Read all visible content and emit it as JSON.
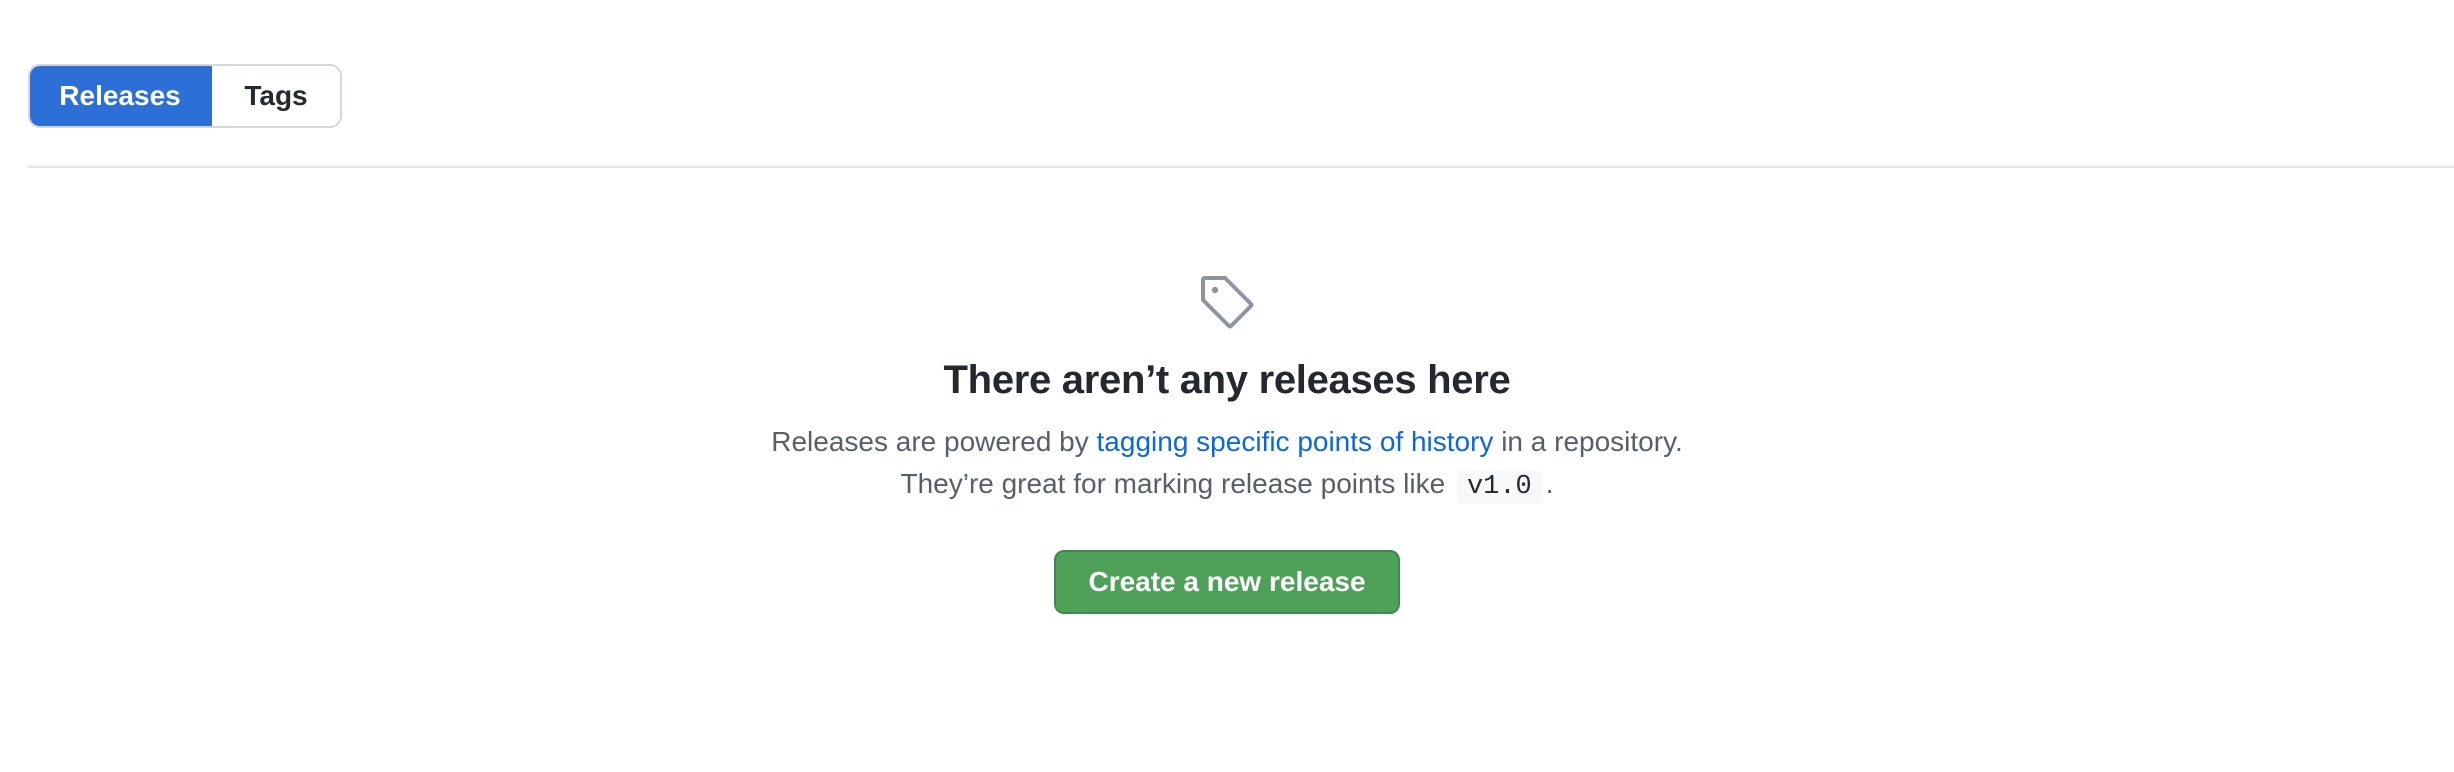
{
  "tabs": {
    "releases_label": "Releases",
    "tags_label": "Tags",
    "selected": "Releases",
    "accent_color": "#2b6fd7"
  },
  "blankslate": {
    "icon": "tag-icon",
    "title": "There aren’t any releases here",
    "line1_prefix": "Releases are powered by ",
    "line1_link": "tagging specific points of history",
    "line1_suffix": " in a repository.",
    "line2_prefix": "They’re great for marking release points like ",
    "line2_code": "v1.0",
    "line2_suffix": ".",
    "link_color": "#0969da"
  },
  "actions": {
    "create_release_label": "Create a new release",
    "button_color": "#4fa15a"
  }
}
